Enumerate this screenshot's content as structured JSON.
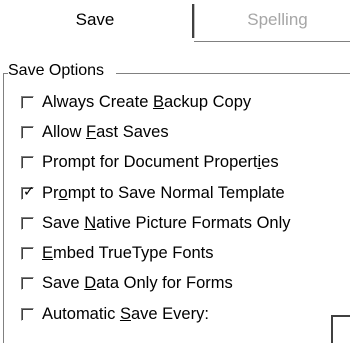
{
  "tabs": {
    "save": "Save",
    "spelling": "Spelling"
  },
  "group": {
    "title": "Save Options"
  },
  "options": [
    {
      "pre": "Always Create ",
      "acc": "B",
      "post": "ackup Copy",
      "checked": false
    },
    {
      "pre": "Allow ",
      "acc": "F",
      "post": "ast Saves",
      "checked": false
    },
    {
      "pre": "Prompt for Document Propert",
      "acc": "i",
      "post": "es",
      "checked": false
    },
    {
      "pre": "Pr",
      "acc": "o",
      "post": "mpt to Save Normal Template",
      "checked": true
    },
    {
      "pre": "Save ",
      "acc": "N",
      "post": "ative Picture Formats Only",
      "checked": false
    },
    {
      "pre": "",
      "acc": "E",
      "post": "mbed TrueType Fonts",
      "checked": false
    },
    {
      "pre": "Save ",
      "acc": "D",
      "post": "ata Only for Forms",
      "checked": false
    },
    {
      "pre": "Automatic ",
      "acc": "S",
      "post": "ave Every:",
      "checked": false
    }
  ],
  "check_glyph": "✓"
}
